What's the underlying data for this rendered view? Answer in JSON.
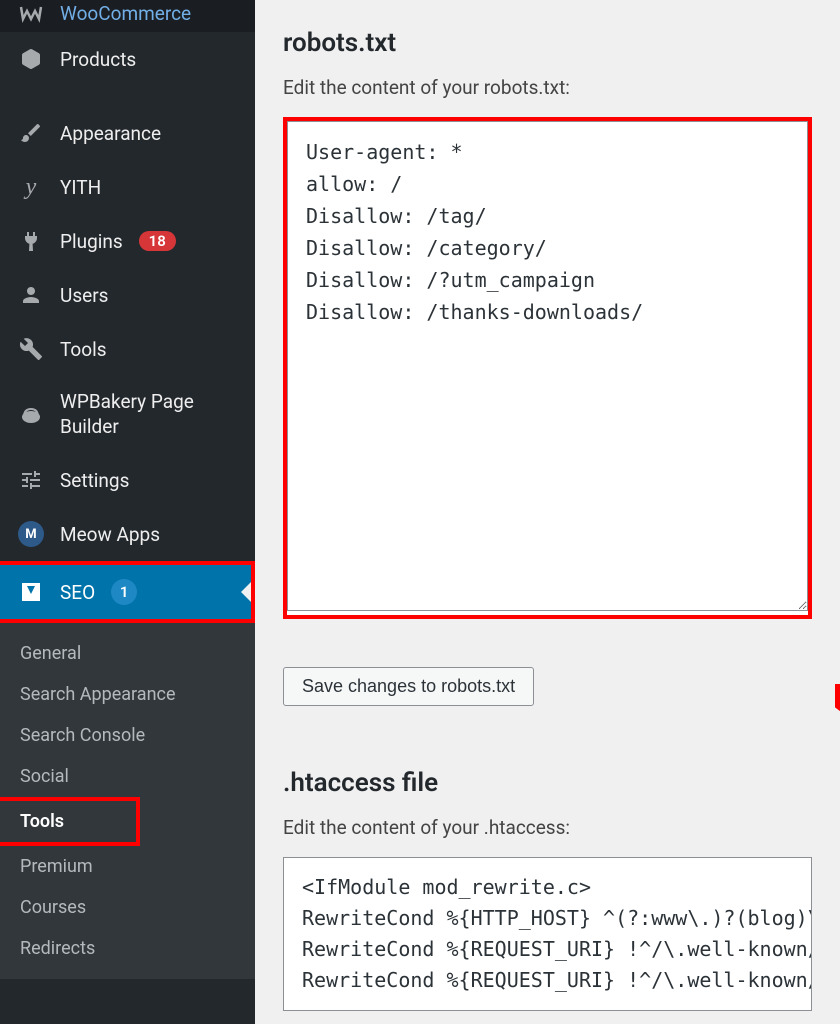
{
  "sidebar": {
    "items": [
      {
        "label": "WooCommerce"
      },
      {
        "label": "Products"
      },
      {
        "label": "Appearance"
      },
      {
        "label": "YITH"
      },
      {
        "label": "Plugins",
        "badge": "18"
      },
      {
        "label": "Users"
      },
      {
        "label": "Tools"
      },
      {
        "label": "WPBakery Page Builder"
      },
      {
        "label": "Settings"
      },
      {
        "label": "Meow Apps"
      },
      {
        "label": "SEO",
        "badge": "1"
      }
    ],
    "submenu": [
      {
        "label": "General"
      },
      {
        "label": "Search Appearance"
      },
      {
        "label": "Search Console"
      },
      {
        "label": "Social"
      },
      {
        "label": "Tools"
      },
      {
        "label": "Premium"
      },
      {
        "label": "Courses"
      },
      {
        "label": "Redirects"
      }
    ]
  },
  "main": {
    "robots": {
      "title": "robots.txt",
      "subtitle": "Edit the content of your robots.txt:",
      "content": "User-agent: *\nallow: /\nDisallow: /tag/\nDisallow: /category/\nDisallow: /?utm_campaign\nDisallow: /thanks-downloads/",
      "save_label": "Save changes to robots.txt"
    },
    "htaccess": {
      "title": ".htaccess file",
      "subtitle": "Edit the content of your .htaccess:",
      "content": "<IfModule mod_rewrite.c>\nRewriteCond %{HTTP_HOST} ^(?:www\\.)?(blog)\\\nRewriteCond %{REQUEST_URI} !^/\\.well-known/\nRewriteCond %{REQUEST_URI} !^/\\.well-known/"
    }
  }
}
